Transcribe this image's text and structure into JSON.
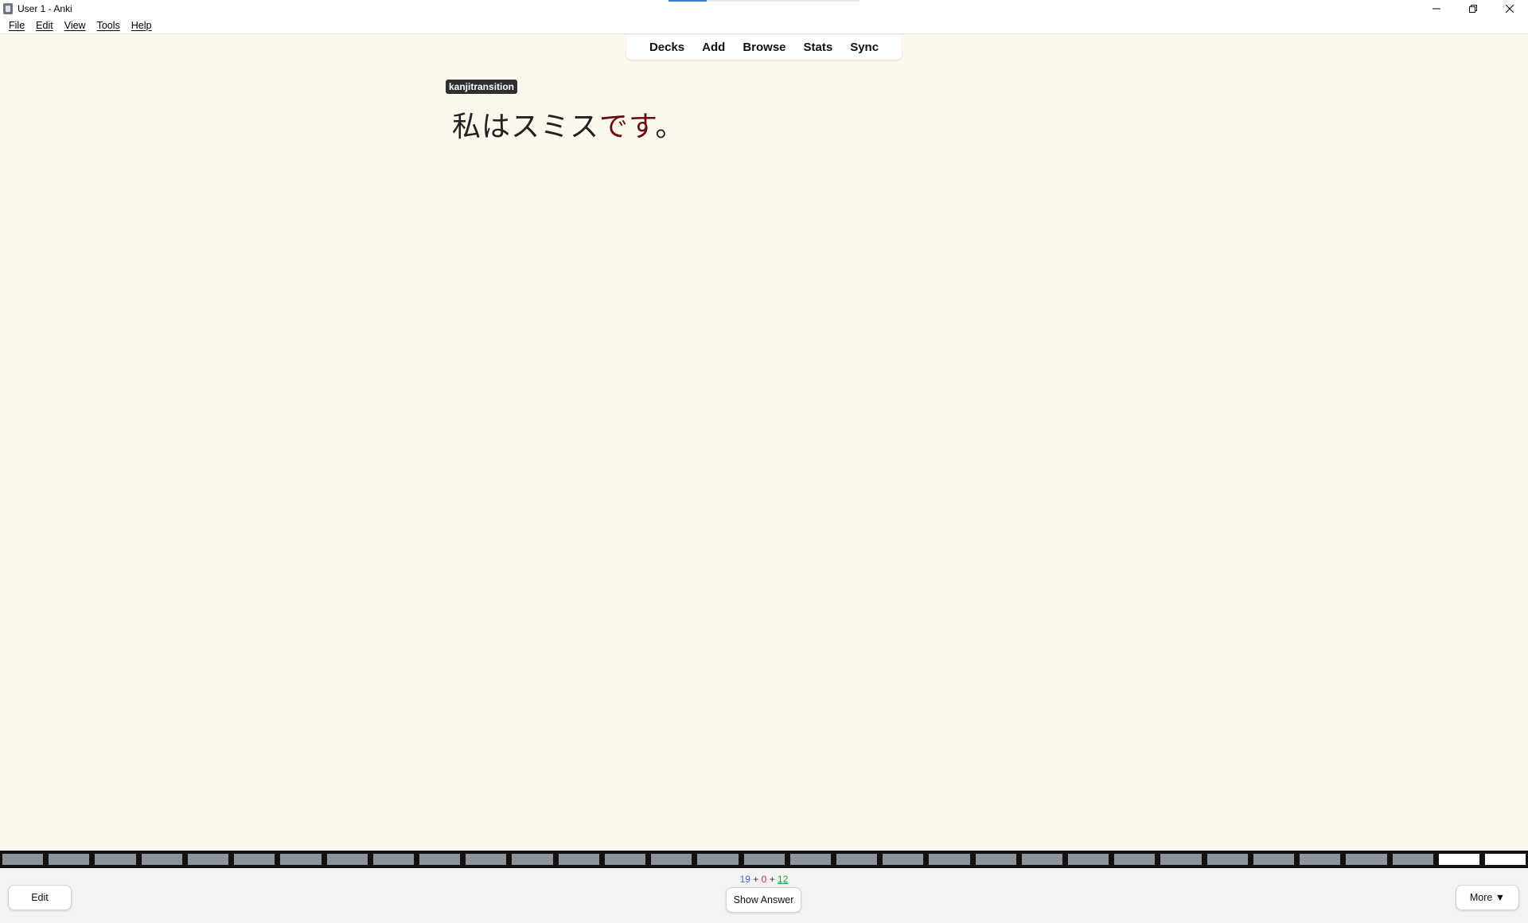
{
  "window": {
    "title": "User 1 - Anki",
    "title_progress_fraction": 0.2
  },
  "menu": {
    "items": [
      "File",
      "Edit",
      "View",
      "Tools",
      "Help"
    ]
  },
  "toolbar": {
    "links": [
      "Decks",
      "Add",
      "Browse",
      "Stats",
      "Sync"
    ]
  },
  "card": {
    "tag": "kanjitransition",
    "sentence_plain": "私はスミス",
    "sentence_highlight": "です",
    "sentence_end": "。"
  },
  "progress": {
    "total_segments": 33,
    "completed_segments": 2
  },
  "counts": {
    "new": "19",
    "learning": "0",
    "review": "12",
    "separator": "+"
  },
  "bottom": {
    "edit_label": "Edit",
    "show_answer_label": "Show Answer",
    "more_label": "More ▼"
  },
  "colors": {
    "background": "#fdf8ee",
    "highlight": "#6b0c0c",
    "new": "#3b6fd6",
    "learning": "#c0392b",
    "review": "#2a9d3a"
  }
}
